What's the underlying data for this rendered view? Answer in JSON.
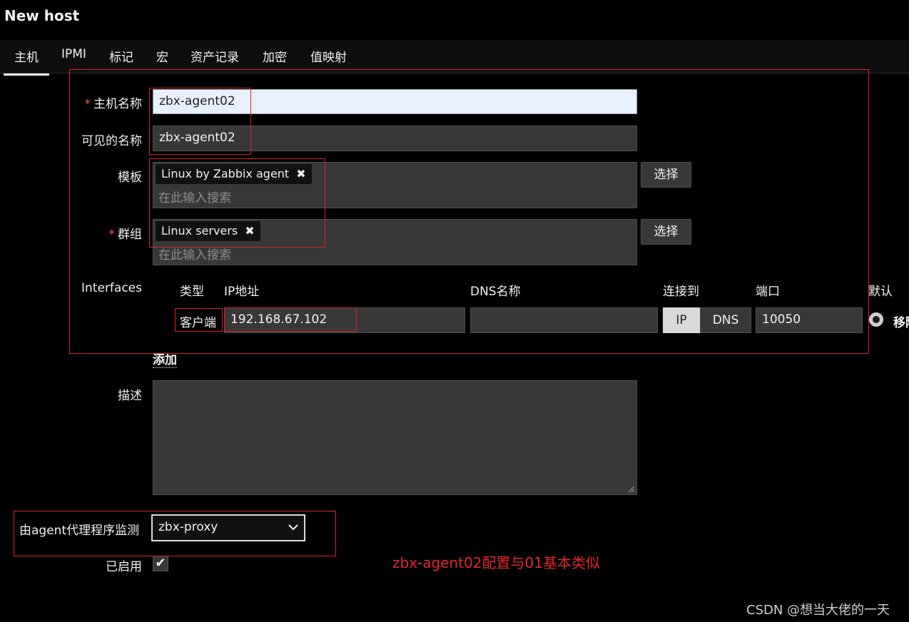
{
  "page": {
    "title": "New host"
  },
  "tabs": [
    {
      "label": "主机",
      "active": true
    },
    {
      "label": "IPMI"
    },
    {
      "label": "标记"
    },
    {
      "label": "宏"
    },
    {
      "label": "资产记录"
    },
    {
      "label": "加密"
    },
    {
      "label": "值映射"
    }
  ],
  "form": {
    "host_name": {
      "required_mark": "*",
      "label": "主机名称",
      "value": "zbx-agent02"
    },
    "visible_name": {
      "label": "可见的名称",
      "value": "zbx-agent02"
    },
    "templates": {
      "label": "模板",
      "tags": [
        "Linux by Zabbix agent"
      ],
      "placeholder": "在此输入搜索",
      "select_label": "选择",
      "remove_icon": "✖"
    },
    "groups": {
      "required_mark": "*",
      "label": "群组",
      "tags": [
        "Linux servers"
      ],
      "placeholder": "在此输入搜索",
      "select_label": "选择",
      "remove_icon": "✖"
    },
    "interfaces": {
      "label": "Interfaces",
      "headers": {
        "type": "类型",
        "ip": "IP地址",
        "dns": "DNS名称",
        "connect": "连接到",
        "port": "端口",
        "default": "默认"
      },
      "row": {
        "type": "客户端",
        "ip": "192.168.67.102",
        "dns": "",
        "connect_ip": "IP",
        "connect_dns": "DNS",
        "port": "10050",
        "remove": "移除"
      },
      "add_link": "添加"
    },
    "description": {
      "label": "描述",
      "value": ""
    },
    "monitored_by_proxy": {
      "label": "由agent代理程序监测",
      "value": "zbx-proxy"
    },
    "enabled": {
      "label": "已启用",
      "checked": true,
      "check_glyph": "✔"
    }
  },
  "annotation": "zbx-agent02配置与01基本类似",
  "watermark": "CSDN @想当大佬的一天",
  "colors": {
    "background": "#000000",
    "field": "#383838",
    "highlight_field": "#e8f0fe",
    "annotation_red": "#e02020"
  }
}
